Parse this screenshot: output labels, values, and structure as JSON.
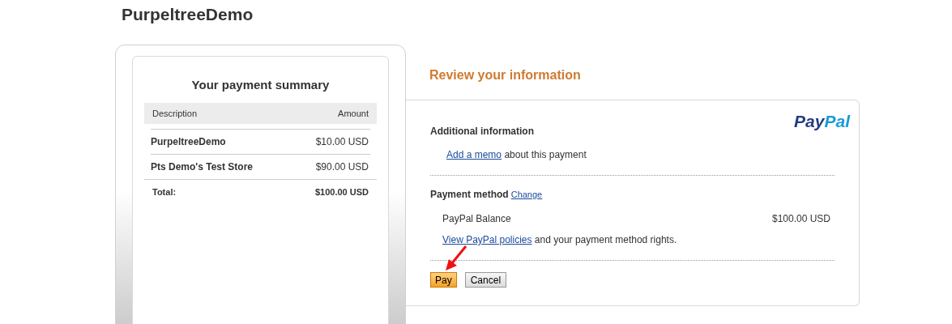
{
  "page_title": "PurpeltreeDemo",
  "summary": {
    "title": "Your payment summary",
    "columns": [
      "Description",
      "Amount"
    ],
    "rows": [
      {
        "description": "PurpeltreeDemo",
        "amount": "$10.00 USD"
      },
      {
        "description": "Pts Demo's Test Store",
        "amount": "$90.00 USD"
      }
    ],
    "total": {
      "label": "Total:",
      "amount": "$100.00 USD"
    }
  },
  "review": {
    "heading": "Review your information",
    "logo": [
      {
        "text": "Pay",
        "color": "#253b80"
      },
      {
        "text": "Pal",
        "color": "#179bd7"
      }
    ],
    "additional": {
      "heading": "Additional information",
      "link": "Add a memo",
      "text": "about this payment"
    },
    "payment_method": {
      "heading": "Payment method",
      "change_link": "Change",
      "source": "PayPal Balance",
      "amount": "$100.00 USD",
      "policies_link": "View PayPal policies",
      "policies_text": "and your payment method rights."
    },
    "buttons": [
      {
        "label": "Pay",
        "kind": "primary"
      },
      {
        "label": "Cancel",
        "kind": "secondary"
      }
    ]
  }
}
